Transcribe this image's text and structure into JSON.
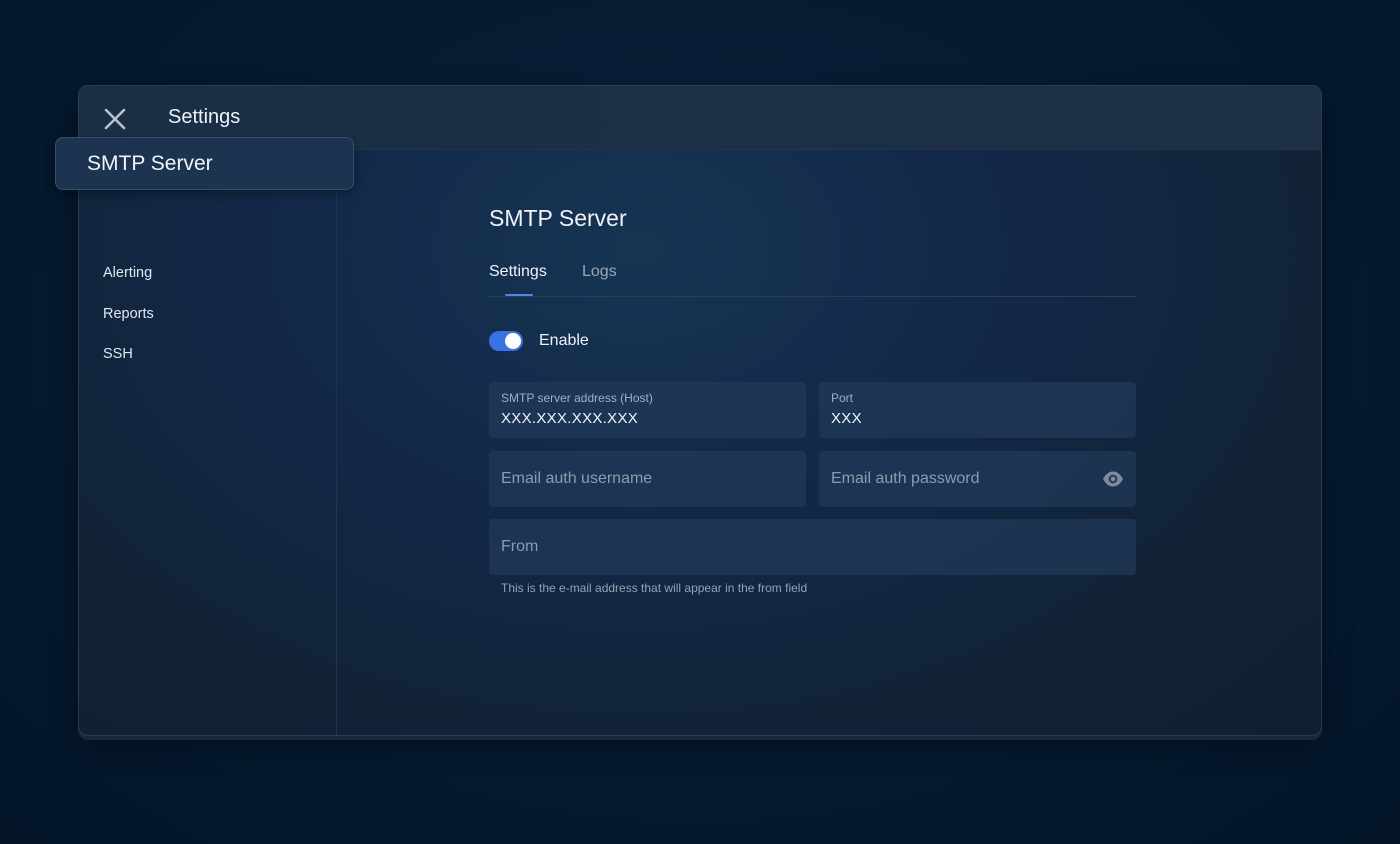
{
  "window": {
    "title": "Settings"
  },
  "sidebar": {
    "selected_item": "SMTP Server",
    "items": [
      {
        "label": "Alerting"
      },
      {
        "label": "Reports"
      },
      {
        "label": "SSH"
      }
    ]
  },
  "main": {
    "heading": "SMTP Server",
    "tabs": [
      {
        "label": "Settings",
        "active": true
      },
      {
        "label": "Logs",
        "active": false
      }
    ],
    "enable_toggle": {
      "label": "Enable",
      "on": true
    },
    "fields": {
      "host": {
        "label": "SMTP server address (Host)",
        "value": "XXX.XXX.XXX.XXX"
      },
      "port": {
        "label": "Port",
        "value": "XXX"
      },
      "username": {
        "placeholder": "Email auth username"
      },
      "password": {
        "placeholder": "Email auth password",
        "icon": "eye-icon"
      },
      "from": {
        "placeholder": "From",
        "helper": "This is the e-mail address that will appear in the from field"
      }
    }
  },
  "colors": {
    "accent": "#3a72e6",
    "background": "#061a30"
  }
}
